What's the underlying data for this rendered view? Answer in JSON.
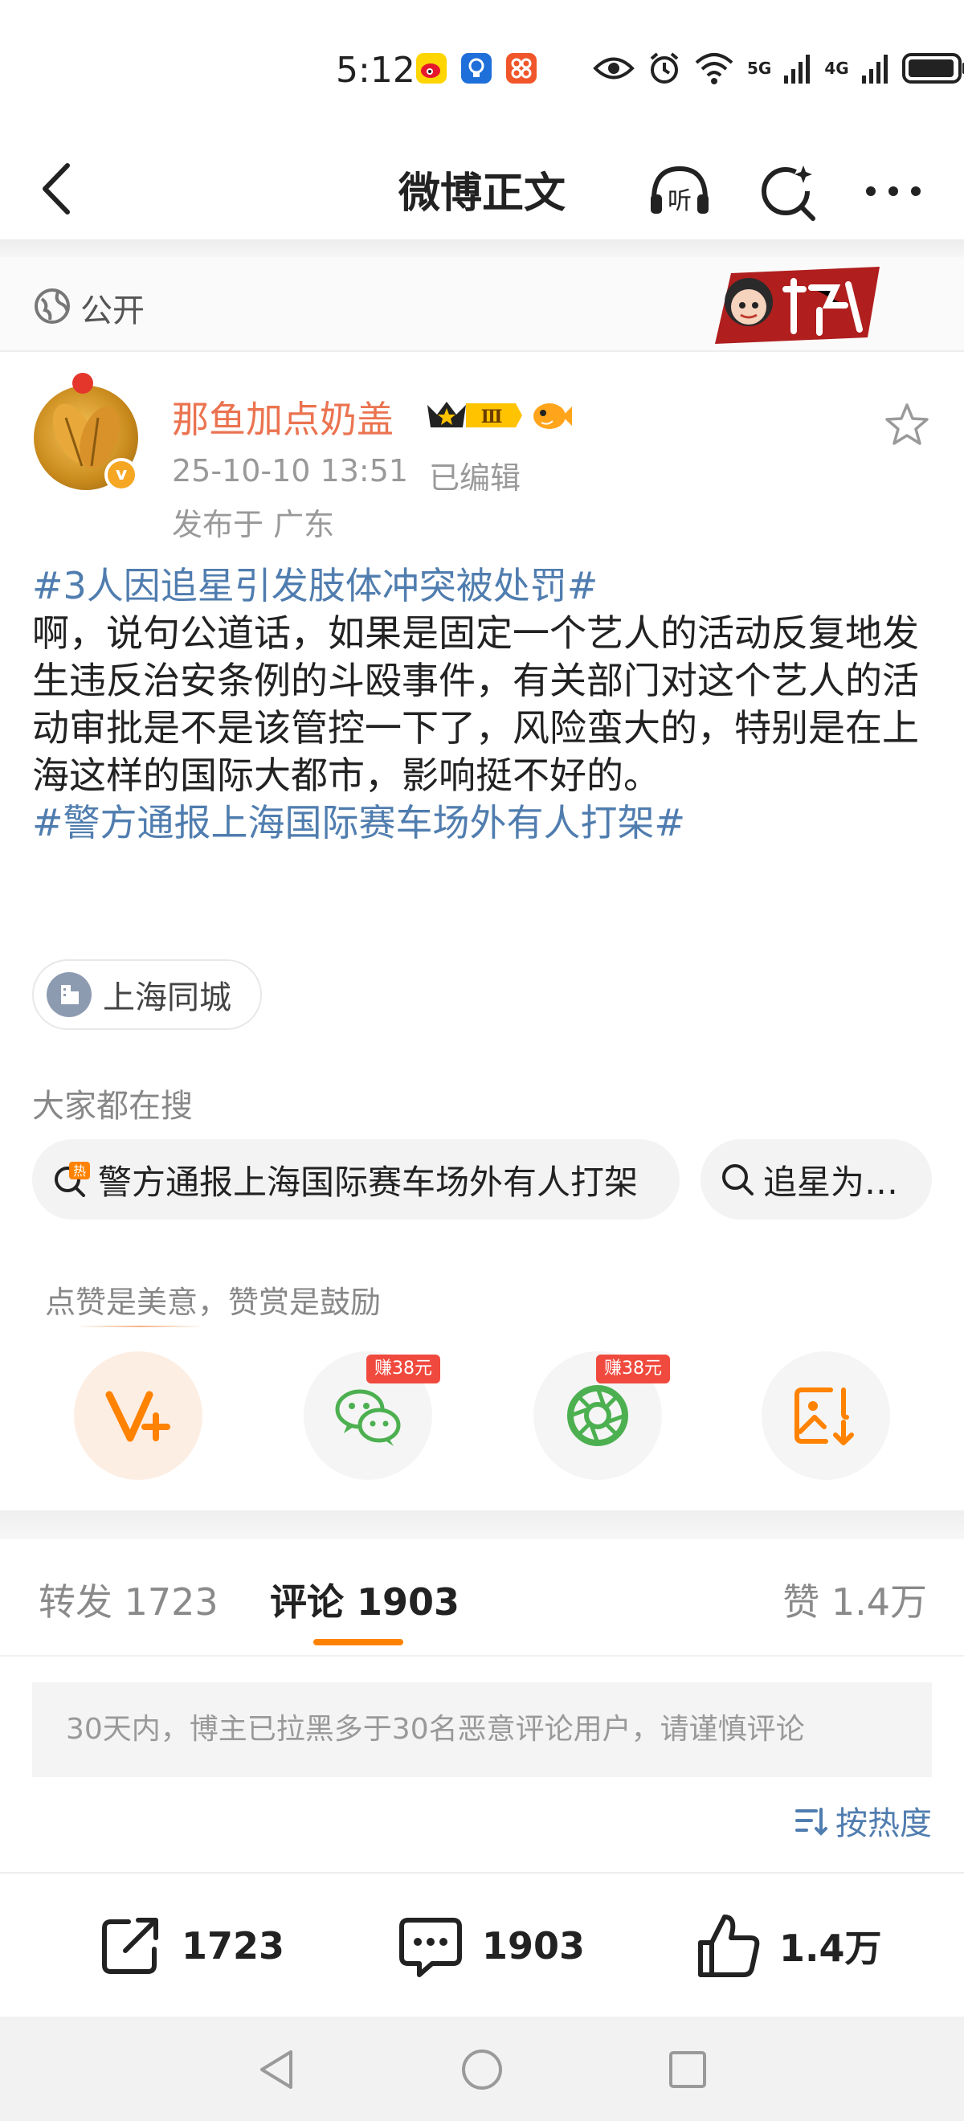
{
  "status_bar": {
    "time": "5:12",
    "network_1": "5G",
    "network_2": "4G",
    "icons": [
      "weibo-app-icon",
      "bulb-app-icon",
      "grid-app-icon",
      "eye-icon",
      "alarm-icon",
      "wifi-icon",
      "signal-icon",
      "battery-icon"
    ]
  },
  "nav": {
    "title": "微博正文",
    "listen_label": "听",
    "icons": [
      "back-icon",
      "listen-icon",
      "search-ai-icon",
      "more-icon"
    ]
  },
  "visibility": {
    "label": "公开"
  },
  "post": {
    "author": "那鱼加点奶盖",
    "vip_level": "Ⅲ",
    "verified_mark": "v",
    "time": "25-10-10 13:51",
    "edited": "已编辑",
    "location": "发布于 广东",
    "hashtag_1": "#3人因追星引发肢体冲突被处罚#",
    "text": "啊，说句公道话，如果是固定一个艺人的活动反复地发生违反治安条例的斗殴事件，有关部门对这个艺人的活动审批是不是该管控一下了，风险蛮大的，特别是在上海这样的国际大都市，影响挺不好的。",
    "hashtag_2": "#警方通报上海国际赛车场外有人打架#",
    "location_chip": "上海同城"
  },
  "search": {
    "title": "大家都在搜",
    "hot_tag": "热",
    "chips": [
      "警方通报上海国际赛车场外有人打架",
      "追星为…"
    ]
  },
  "reward": {
    "hint": "点赞是美意，赞赏是鼓励",
    "earn_tag_1": "赚38元",
    "earn_tag_2": "赚38元",
    "buttons": [
      "vplus-icon",
      "wechat-icon",
      "moments-icon",
      "save-image-icon"
    ]
  },
  "tabs": {
    "repost": "转发 1723",
    "comment": "评论 1903",
    "like": "赞 1.4万",
    "active": "comment"
  },
  "comments": {
    "notice": "30天内，博主已拉黑多于30名恶意评论用户，请谨慎评论",
    "sort_label": "按热度"
  },
  "actions": {
    "repost_count": "1723",
    "comment_count": "1903",
    "like_count": "1.4万"
  },
  "colors": {
    "accent_orange": "#ff8200",
    "username": "#eb7350",
    "link_blue": "#507daf",
    "earn_red": "#f04a3e"
  }
}
